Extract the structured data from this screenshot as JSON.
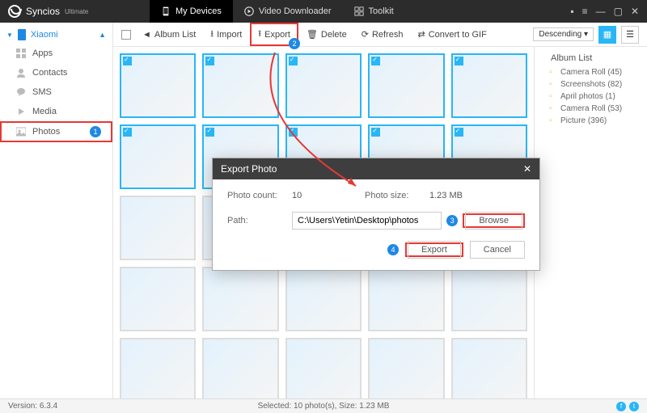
{
  "app": {
    "name": "Syncios",
    "edition": "Ultimate"
  },
  "nav": {
    "my_devices": "My Devices",
    "video_downloader": "Video Downloader",
    "toolkit": "Toolkit"
  },
  "device": {
    "name": "Xiaomi"
  },
  "sidebar": {
    "apps": "Apps",
    "contacts": "Contacts",
    "sms": "SMS",
    "media": "Media",
    "photos": "Photos",
    "photos_badge": "1"
  },
  "toolbar": {
    "album_list": "Album List",
    "import": "Import",
    "export": "Export",
    "export_badge": "2",
    "delete": "Delete",
    "refresh": "Refresh",
    "convert": "Convert to GIF",
    "sort": "Descending"
  },
  "albums": {
    "title": "Album List",
    "items": [
      "Camera Roll (45)",
      "Screenshots (82)",
      "April photos (1)",
      "Camera Roll (53)",
      "Picture (396)"
    ]
  },
  "dialog": {
    "title": "Export Photo",
    "count_label": "Photo count:",
    "count_value": "10",
    "size_label": "Photo size:",
    "size_value": "1.23 MB",
    "path_label": "Path:",
    "path_value": "C:\\Users\\Yetin\\Desktop\\photos",
    "browse": "Browse",
    "browse_badge": "3",
    "export": "Export",
    "export_badge": "4",
    "cancel": "Cancel"
  },
  "status": {
    "version": "Version: 6.3.4",
    "selection": "Selected: 10 photo(s), Size: 1.23 MB"
  }
}
